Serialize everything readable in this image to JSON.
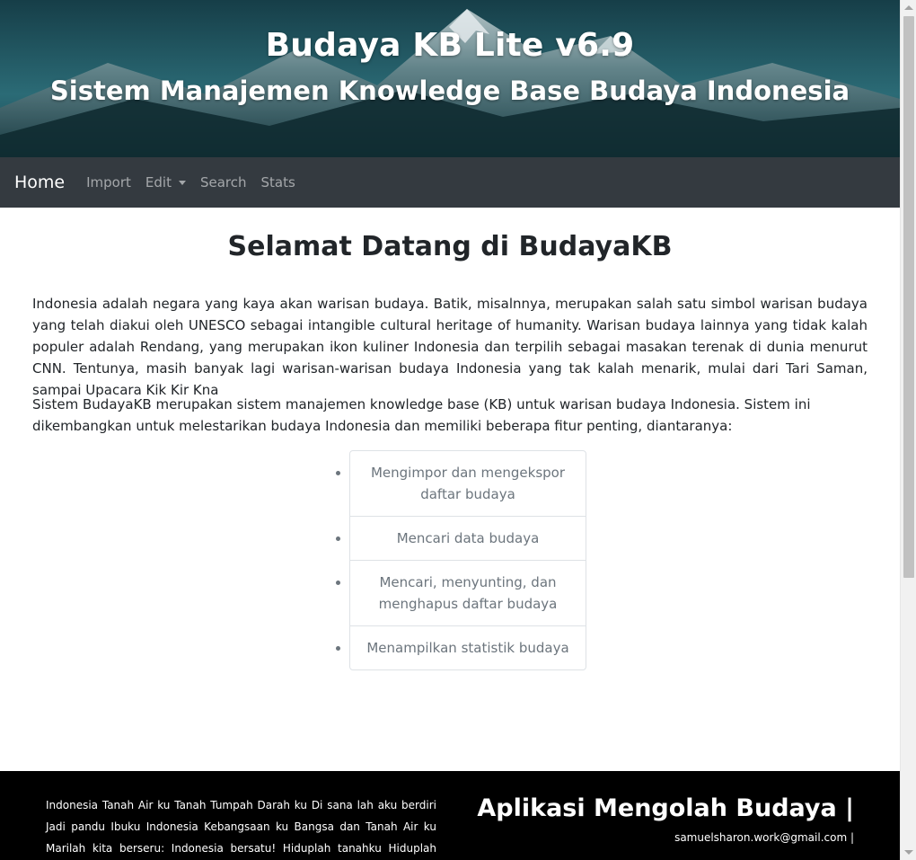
{
  "header": {
    "title": "Budaya KB Lite v6.9",
    "subtitle": "Sistem Manajemen Knowledge Base Budaya Indonesia"
  },
  "navbar": {
    "brand": "Home",
    "items": [
      {
        "label": "Import"
      },
      {
        "label": "Edit"
      },
      {
        "label": "Search"
      },
      {
        "label": "Stats"
      }
    ]
  },
  "main": {
    "title": "Selamat Datang di BudayaKB",
    "paragraph1": "Indonesia adalah negara yang kaya akan warisan budaya. Batik, misalnnya, merupakan salah satu simbol warisan budaya yang telah diakui oleh UNESCO sebagai intangible cultural heritage of humanity. Warisan budaya lainnya yang tidak kalah populer adalah Rendang, yang merupakan ikon kuliner Indonesia dan terpilih sebagai masakan terenak di dunia menurut CNN. Tentunya, masih banyak lagi warisan-warisan budaya Indonesia yang tak kalah menarik, mulai dari Tari Saman, sampai Upacara Kik Kir Kna",
    "paragraph2": "Sistem BudayaKB merupakan sistem manajemen knowledge base (KB) untuk warisan budaya Indonesia. Sistem ini dikembangkan untuk melestarikan budaya Indonesia dan memiliki beberapa fitur penting, diantaranya:",
    "features": [
      "Mengimpor dan mengekspor daftar budaya",
      "Mencari data budaya",
      "Mencari, menyunting, dan menghapus daftar budaya",
      "Menampilkan statistik budaya"
    ]
  },
  "footer": {
    "text": "Indonesia Tanah Air ku Tanah Tumpah Darah ku Di sana lah aku berdiri Jadi pandu Ibuku Indonesia Kebangsaan ku Bangsa dan Tanah Air ku Marilah kita berseru: Indonesia bersatu! Hiduplah tanahku Hiduplah negeriku Bangsaku",
    "title": "Aplikasi Mengolah Budaya |",
    "email": "samuelsharon.work@gmail.com |"
  },
  "colors": {
    "navbar_bg": "#343a40",
    "footer_bg": "#000000",
    "muted_text": "#6c757d"
  }
}
